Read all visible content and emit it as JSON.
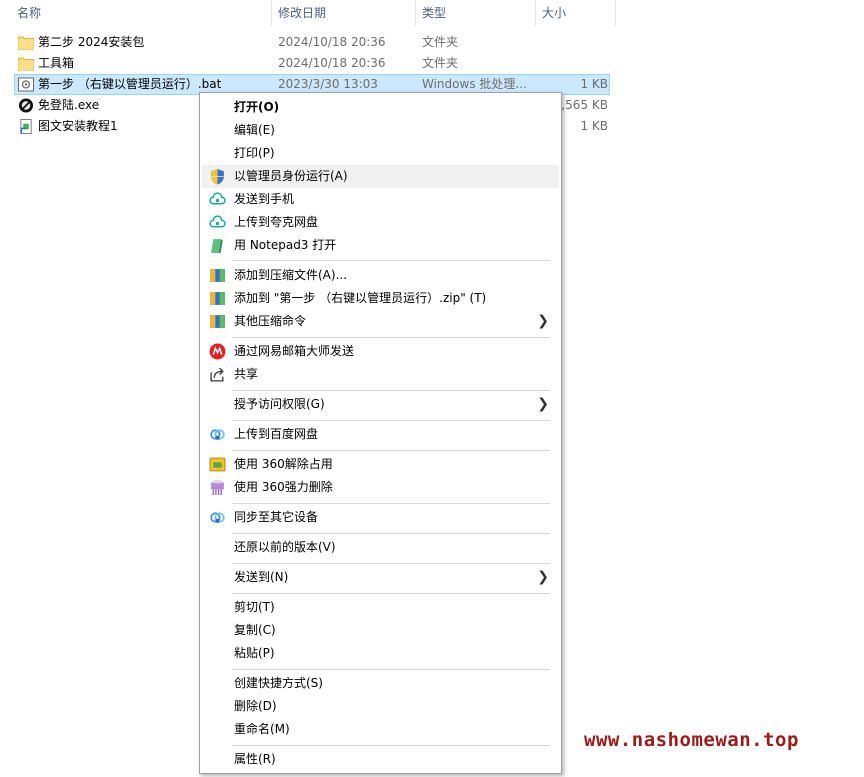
{
  "columns": {
    "name": "名称",
    "date": "修改日期",
    "type": "类型",
    "size": "大小"
  },
  "files": [
    {
      "name": "第二步 2024安装包",
      "date": "2024/10/18 20:36",
      "type": "文件夹",
      "size": "",
      "icon": "folder-icon"
    },
    {
      "name": "工具箱",
      "date": "2024/10/18 20:36",
      "type": "文件夹",
      "size": "",
      "icon": "folder-icon"
    },
    {
      "name": "第一步 （右键以管理员运行）.bat",
      "date": "2023/3/30 13:03",
      "type": "Windows 批处理...",
      "size": "1 KB",
      "icon": "batch-file-icon"
    },
    {
      "name": "免登陆.exe",
      "date": "",
      "type": "",
      "size": "1,565 KB",
      "icon": "exe-icon"
    },
    {
      "name": "图文安装教程1",
      "date": "",
      "type": "",
      "size": "1 KB",
      "icon": "shortcut-icon"
    }
  ],
  "menu": {
    "open": "打开(O)",
    "edit": "编辑(E)",
    "print": "打印(P)",
    "run_as_admin": "以管理员身份运行(A)",
    "send_to_phone": "发送到手机",
    "upload_quark": "上传到夸克网盘",
    "open_notepad3": "用 Notepad3 打开",
    "add_archive": "添加到压缩文件(A)...",
    "add_to_zip": "添加到 \"第一步 （右键以管理员运行）.zip\" (T)",
    "other_compress": "其他压缩命令",
    "netease_mail": "通过网易邮箱大师发送",
    "share": "共享",
    "grant_access": "授予访问权限(G)",
    "upload_baidu": "上传到百度网盘",
    "unlock_360": "使用 360解除占用",
    "delete_360": "使用 360强力删除",
    "sync_devices": "同步至其它设备",
    "restore_versions": "还原以前的版本(V)",
    "send_to": "发送到(N)",
    "cut": "剪切(T)",
    "copy": "复制(C)",
    "paste": "粘贴(P)",
    "create_shortcut": "创建快捷方式(S)",
    "delete": "删除(D)",
    "rename": "重命名(M)",
    "properties": "属性(R)"
  },
  "watermark": "www.nashomewan.top",
  "colors": {
    "selection": "#cce8ff",
    "selection_border": "#99d1ff",
    "watermark": "#9b1b1b"
  }
}
